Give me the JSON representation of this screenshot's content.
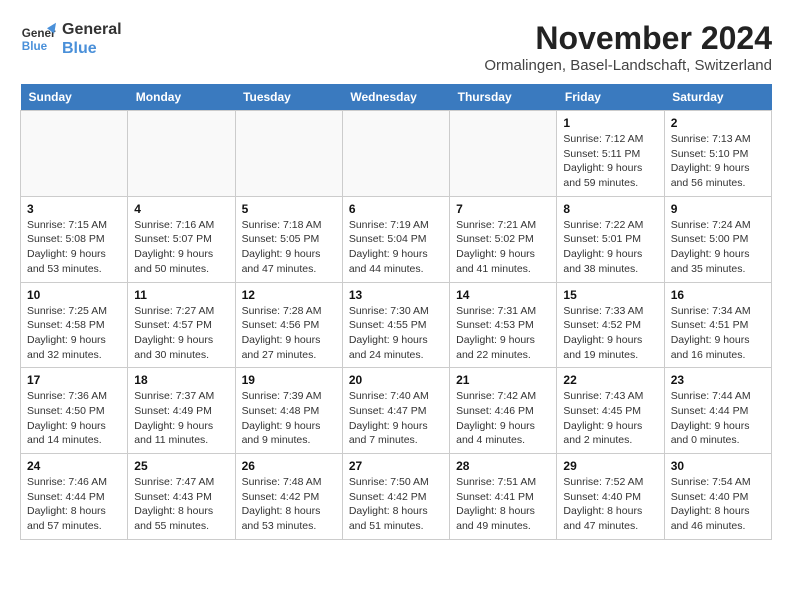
{
  "logo": {
    "line1": "General",
    "line2": "Blue"
  },
  "title": "November 2024",
  "location": "Ormalingen, Basel-Landschaft, Switzerland",
  "days_of_week": [
    "Sunday",
    "Monday",
    "Tuesday",
    "Wednesday",
    "Thursday",
    "Friday",
    "Saturday"
  ],
  "weeks": [
    [
      {
        "day": "",
        "info": ""
      },
      {
        "day": "",
        "info": ""
      },
      {
        "day": "",
        "info": ""
      },
      {
        "day": "",
        "info": ""
      },
      {
        "day": "",
        "info": ""
      },
      {
        "day": "1",
        "info": "Sunrise: 7:12 AM\nSunset: 5:11 PM\nDaylight: 9 hours and 59 minutes."
      },
      {
        "day": "2",
        "info": "Sunrise: 7:13 AM\nSunset: 5:10 PM\nDaylight: 9 hours and 56 minutes."
      }
    ],
    [
      {
        "day": "3",
        "info": "Sunrise: 7:15 AM\nSunset: 5:08 PM\nDaylight: 9 hours and 53 minutes."
      },
      {
        "day": "4",
        "info": "Sunrise: 7:16 AM\nSunset: 5:07 PM\nDaylight: 9 hours and 50 minutes."
      },
      {
        "day": "5",
        "info": "Sunrise: 7:18 AM\nSunset: 5:05 PM\nDaylight: 9 hours and 47 minutes."
      },
      {
        "day": "6",
        "info": "Sunrise: 7:19 AM\nSunset: 5:04 PM\nDaylight: 9 hours and 44 minutes."
      },
      {
        "day": "7",
        "info": "Sunrise: 7:21 AM\nSunset: 5:02 PM\nDaylight: 9 hours and 41 minutes."
      },
      {
        "day": "8",
        "info": "Sunrise: 7:22 AM\nSunset: 5:01 PM\nDaylight: 9 hours and 38 minutes."
      },
      {
        "day": "9",
        "info": "Sunrise: 7:24 AM\nSunset: 5:00 PM\nDaylight: 9 hours and 35 minutes."
      }
    ],
    [
      {
        "day": "10",
        "info": "Sunrise: 7:25 AM\nSunset: 4:58 PM\nDaylight: 9 hours and 32 minutes."
      },
      {
        "day": "11",
        "info": "Sunrise: 7:27 AM\nSunset: 4:57 PM\nDaylight: 9 hours and 30 minutes."
      },
      {
        "day": "12",
        "info": "Sunrise: 7:28 AM\nSunset: 4:56 PM\nDaylight: 9 hours and 27 minutes."
      },
      {
        "day": "13",
        "info": "Sunrise: 7:30 AM\nSunset: 4:55 PM\nDaylight: 9 hours and 24 minutes."
      },
      {
        "day": "14",
        "info": "Sunrise: 7:31 AM\nSunset: 4:53 PM\nDaylight: 9 hours and 22 minutes."
      },
      {
        "day": "15",
        "info": "Sunrise: 7:33 AM\nSunset: 4:52 PM\nDaylight: 9 hours and 19 minutes."
      },
      {
        "day": "16",
        "info": "Sunrise: 7:34 AM\nSunset: 4:51 PM\nDaylight: 9 hours and 16 minutes."
      }
    ],
    [
      {
        "day": "17",
        "info": "Sunrise: 7:36 AM\nSunset: 4:50 PM\nDaylight: 9 hours and 14 minutes."
      },
      {
        "day": "18",
        "info": "Sunrise: 7:37 AM\nSunset: 4:49 PM\nDaylight: 9 hours and 11 minutes."
      },
      {
        "day": "19",
        "info": "Sunrise: 7:39 AM\nSunset: 4:48 PM\nDaylight: 9 hours and 9 minutes."
      },
      {
        "day": "20",
        "info": "Sunrise: 7:40 AM\nSunset: 4:47 PM\nDaylight: 9 hours and 7 minutes."
      },
      {
        "day": "21",
        "info": "Sunrise: 7:42 AM\nSunset: 4:46 PM\nDaylight: 9 hours and 4 minutes."
      },
      {
        "day": "22",
        "info": "Sunrise: 7:43 AM\nSunset: 4:45 PM\nDaylight: 9 hours and 2 minutes."
      },
      {
        "day": "23",
        "info": "Sunrise: 7:44 AM\nSunset: 4:44 PM\nDaylight: 9 hours and 0 minutes."
      }
    ],
    [
      {
        "day": "24",
        "info": "Sunrise: 7:46 AM\nSunset: 4:44 PM\nDaylight: 8 hours and 57 minutes."
      },
      {
        "day": "25",
        "info": "Sunrise: 7:47 AM\nSunset: 4:43 PM\nDaylight: 8 hours and 55 minutes."
      },
      {
        "day": "26",
        "info": "Sunrise: 7:48 AM\nSunset: 4:42 PM\nDaylight: 8 hours and 53 minutes."
      },
      {
        "day": "27",
        "info": "Sunrise: 7:50 AM\nSunset: 4:42 PM\nDaylight: 8 hours and 51 minutes."
      },
      {
        "day": "28",
        "info": "Sunrise: 7:51 AM\nSunset: 4:41 PM\nDaylight: 8 hours and 49 minutes."
      },
      {
        "day": "29",
        "info": "Sunrise: 7:52 AM\nSunset: 4:40 PM\nDaylight: 8 hours and 47 minutes."
      },
      {
        "day": "30",
        "info": "Sunrise: 7:54 AM\nSunset: 4:40 PM\nDaylight: 8 hours and 46 minutes."
      }
    ]
  ]
}
